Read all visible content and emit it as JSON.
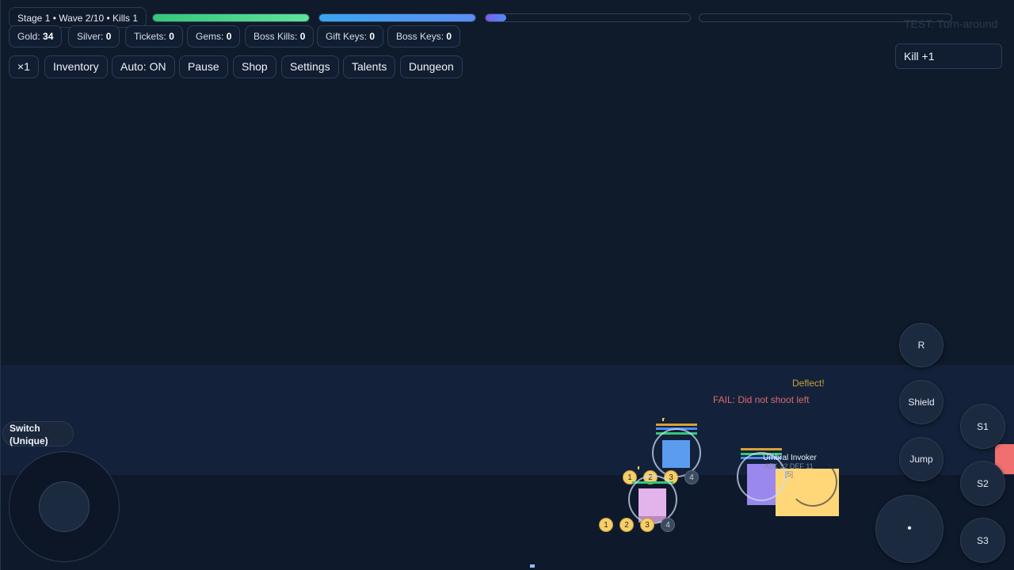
{
  "hud": {
    "status": "Stage 1 • Wave 2/10 • Kills 1",
    "bars": [
      {
        "name": "hp-bar",
        "fill": 1.0,
        "color": "#34c77b",
        "color2": "#5ee39a"
      },
      {
        "name": "mana-bar",
        "fill": 1.0,
        "color": "#3aa6f0",
        "color2": "#5b8ef5"
      },
      {
        "name": "xp-bar",
        "fill": 0.1,
        "color": "#7b5cf0",
        "color2": "#4f8df5"
      },
      {
        "name": "wave-progress-bar",
        "fill": 0.0,
        "color": "#4f8df5",
        "color2": "#4f8df5"
      }
    ]
  },
  "currencies": [
    {
      "label": "Gold:",
      "value": "34"
    },
    {
      "label": "Silver:",
      "value": "0"
    },
    {
      "label": "Tickets:",
      "value": "0"
    },
    {
      "label": "Gems:",
      "value": "0"
    },
    {
      "label": "Boss Kills:",
      "value": "0"
    },
    {
      "label": "Gift Keys:",
      "value": "0"
    },
    {
      "label": "Boss Keys:",
      "value": "0"
    }
  ],
  "menu": {
    "speed": "×1",
    "inventory": "Inventory",
    "auto": "Auto: ON",
    "pause": "Pause",
    "shop": "Shop",
    "settings": "Settings",
    "talents": "Talents",
    "dungeon": "Dungeon"
  },
  "test_title": "TEST: Turn-around",
  "toast": "Kill +1",
  "controls": {
    "reload": "R",
    "shield": "Shield",
    "jump": "Jump",
    "skill1": "S1",
    "skill2": "S2",
    "skill3": "S3",
    "switch": "Switch\n(Unique)",
    "attack": "•"
  },
  "combat": {
    "deflect": "Deflect!",
    "fail": "FAIL: Did not shoot left",
    "enemy_name": "Umbral Invoker",
    "enemy_stats": "ATK 32  DEF 11",
    "enemy_tag": "[5]"
  },
  "slots_upper": [
    "1",
    "2",
    "3",
    "4"
  ],
  "slots_lower": [
    "1",
    "2",
    "3",
    "4"
  ],
  "colors": {
    "player": "#5b9cf0",
    "ally": "#e3b3ec",
    "enemy": "#9a88ee",
    "enemy_shield": "#ffd778",
    "deflect": "#c8a23a",
    "fail": "#d96b6b"
  }
}
